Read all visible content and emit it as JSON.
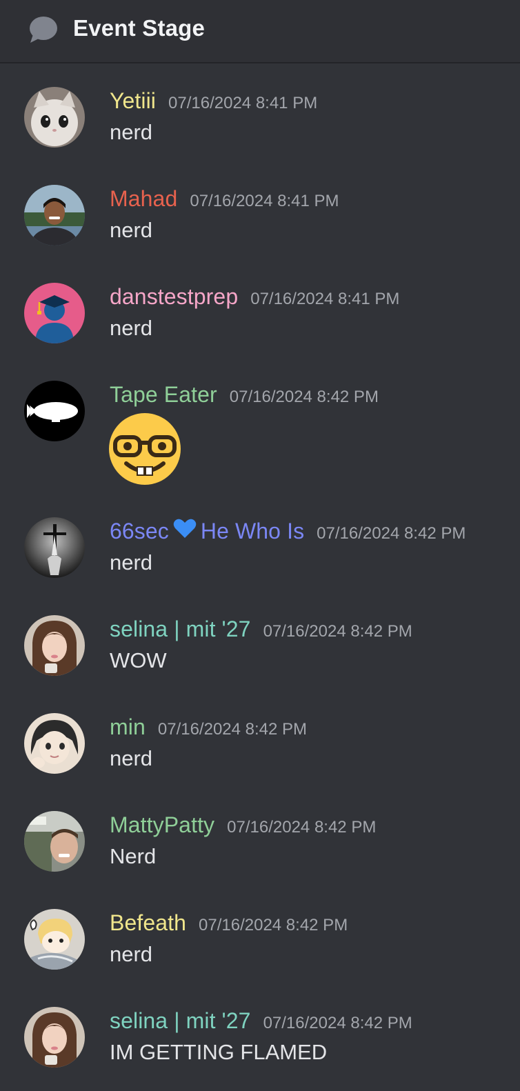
{
  "header": {
    "channel_title": "Event Stage",
    "channel_icon": "speech-bubble-icon"
  },
  "colors": {
    "background": "#313338",
    "header_background": "#2f3035",
    "timestamp": "#a3a6ac",
    "message_text": "#e4e5e8"
  },
  "messages": [
    {
      "username": "Yetiii",
      "username_color": "#f0e68c",
      "timestamp": "07/16/2024 8:41 PM",
      "text": "nerd",
      "avatar": "cat-avatar"
    },
    {
      "username": "Mahad",
      "username_color": "#e8624e",
      "timestamp": "07/16/2024 8:41 PM",
      "text": "nerd",
      "avatar": "person-photo-avatar"
    },
    {
      "username": "danstestprep",
      "username_color": "#f6a6c8",
      "timestamp": "07/16/2024 8:41 PM",
      "text": "nerd",
      "avatar": "graduate-avatar"
    },
    {
      "username": "Tape Eater",
      "username_color": "#8fcf98",
      "timestamp": "07/16/2024 8:42 PM",
      "text": "",
      "emoji": "nerd-face-emoji",
      "avatar": "blimp-avatar"
    },
    {
      "username_part1": "66sec",
      "username_part2": "He Who Is",
      "username_color": "#7b87f5",
      "timestamp": "07/16/2024 8:42 PM",
      "text": "nerd",
      "username_emoji": "blue-heart-icon",
      "avatar": "crucifix-avatar"
    },
    {
      "username": "selina | mit '27",
      "username_color": "#7fd3c0",
      "timestamp": "07/16/2024 8:42 PM",
      "text": "WOW",
      "avatar": "selina-photo-avatar"
    },
    {
      "username": "min",
      "username_color": "#8fcf98",
      "timestamp": "07/16/2024 8:42 PM",
      "text": "nerd",
      "avatar": "anime-avatar"
    },
    {
      "username": "MattyPatty",
      "username_color": "#8fcf98",
      "timestamp": "07/16/2024 8:42 PM",
      "text": "Nerd",
      "avatar": "selfie-photo-avatar"
    },
    {
      "username": "Befeath",
      "username_color": "#f0e68c",
      "timestamp": "07/16/2024 8:42 PM",
      "text": "nerd",
      "avatar": "cartoon-avatar"
    },
    {
      "username": "selina | mit '27",
      "username_color": "#7fd3c0",
      "timestamp": "07/16/2024 8:42 PM",
      "text": "IM GETTING FLAMED",
      "avatar": "selina-photo-avatar"
    }
  ]
}
